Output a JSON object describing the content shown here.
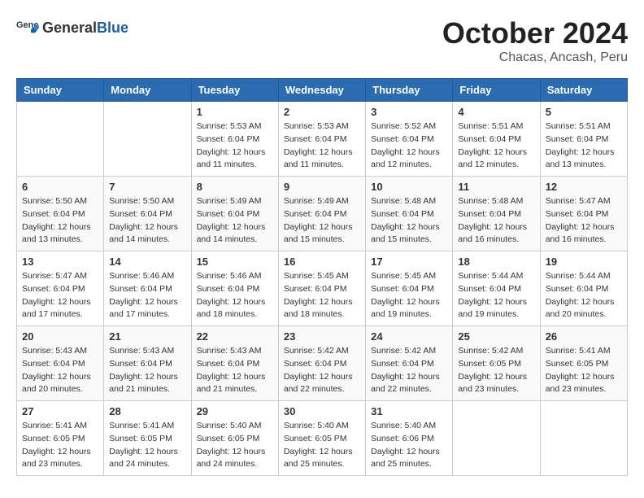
{
  "header": {
    "logo_general": "General",
    "logo_blue": "Blue",
    "month": "October 2024",
    "location": "Chacas, Ancash, Peru"
  },
  "weekdays": [
    "Sunday",
    "Monday",
    "Tuesday",
    "Wednesday",
    "Thursday",
    "Friday",
    "Saturday"
  ],
  "weeks": [
    [
      {
        "day": "",
        "details": ""
      },
      {
        "day": "",
        "details": ""
      },
      {
        "day": "1",
        "details": "Sunrise: 5:53 AM\nSunset: 6:04 PM\nDaylight: 12 hours and 11 minutes."
      },
      {
        "day": "2",
        "details": "Sunrise: 5:53 AM\nSunset: 6:04 PM\nDaylight: 12 hours and 11 minutes."
      },
      {
        "day": "3",
        "details": "Sunrise: 5:52 AM\nSunset: 6:04 PM\nDaylight: 12 hours and 12 minutes."
      },
      {
        "day": "4",
        "details": "Sunrise: 5:51 AM\nSunset: 6:04 PM\nDaylight: 12 hours and 12 minutes."
      },
      {
        "day": "5",
        "details": "Sunrise: 5:51 AM\nSunset: 6:04 PM\nDaylight: 12 hours and 13 minutes."
      }
    ],
    [
      {
        "day": "6",
        "details": "Sunrise: 5:50 AM\nSunset: 6:04 PM\nDaylight: 12 hours and 13 minutes."
      },
      {
        "day": "7",
        "details": "Sunrise: 5:50 AM\nSunset: 6:04 PM\nDaylight: 12 hours and 14 minutes."
      },
      {
        "day": "8",
        "details": "Sunrise: 5:49 AM\nSunset: 6:04 PM\nDaylight: 12 hours and 14 minutes."
      },
      {
        "day": "9",
        "details": "Sunrise: 5:49 AM\nSunset: 6:04 PM\nDaylight: 12 hours and 15 minutes."
      },
      {
        "day": "10",
        "details": "Sunrise: 5:48 AM\nSunset: 6:04 PM\nDaylight: 12 hours and 15 minutes."
      },
      {
        "day": "11",
        "details": "Sunrise: 5:48 AM\nSunset: 6:04 PM\nDaylight: 12 hours and 16 minutes."
      },
      {
        "day": "12",
        "details": "Sunrise: 5:47 AM\nSunset: 6:04 PM\nDaylight: 12 hours and 16 minutes."
      }
    ],
    [
      {
        "day": "13",
        "details": "Sunrise: 5:47 AM\nSunset: 6:04 PM\nDaylight: 12 hours and 17 minutes."
      },
      {
        "day": "14",
        "details": "Sunrise: 5:46 AM\nSunset: 6:04 PM\nDaylight: 12 hours and 17 minutes."
      },
      {
        "day": "15",
        "details": "Sunrise: 5:46 AM\nSunset: 6:04 PM\nDaylight: 12 hours and 18 minutes."
      },
      {
        "day": "16",
        "details": "Sunrise: 5:45 AM\nSunset: 6:04 PM\nDaylight: 12 hours and 18 minutes."
      },
      {
        "day": "17",
        "details": "Sunrise: 5:45 AM\nSunset: 6:04 PM\nDaylight: 12 hours and 19 minutes."
      },
      {
        "day": "18",
        "details": "Sunrise: 5:44 AM\nSunset: 6:04 PM\nDaylight: 12 hours and 19 minutes."
      },
      {
        "day": "19",
        "details": "Sunrise: 5:44 AM\nSunset: 6:04 PM\nDaylight: 12 hours and 20 minutes."
      }
    ],
    [
      {
        "day": "20",
        "details": "Sunrise: 5:43 AM\nSunset: 6:04 PM\nDaylight: 12 hours and 20 minutes."
      },
      {
        "day": "21",
        "details": "Sunrise: 5:43 AM\nSunset: 6:04 PM\nDaylight: 12 hours and 21 minutes."
      },
      {
        "day": "22",
        "details": "Sunrise: 5:43 AM\nSunset: 6:04 PM\nDaylight: 12 hours and 21 minutes."
      },
      {
        "day": "23",
        "details": "Sunrise: 5:42 AM\nSunset: 6:04 PM\nDaylight: 12 hours and 22 minutes."
      },
      {
        "day": "24",
        "details": "Sunrise: 5:42 AM\nSunset: 6:04 PM\nDaylight: 12 hours and 22 minutes."
      },
      {
        "day": "25",
        "details": "Sunrise: 5:42 AM\nSunset: 6:05 PM\nDaylight: 12 hours and 23 minutes."
      },
      {
        "day": "26",
        "details": "Sunrise: 5:41 AM\nSunset: 6:05 PM\nDaylight: 12 hours and 23 minutes."
      }
    ],
    [
      {
        "day": "27",
        "details": "Sunrise: 5:41 AM\nSunset: 6:05 PM\nDaylight: 12 hours and 23 minutes."
      },
      {
        "day": "28",
        "details": "Sunrise: 5:41 AM\nSunset: 6:05 PM\nDaylight: 12 hours and 24 minutes."
      },
      {
        "day": "29",
        "details": "Sunrise: 5:40 AM\nSunset: 6:05 PM\nDaylight: 12 hours and 24 minutes."
      },
      {
        "day": "30",
        "details": "Sunrise: 5:40 AM\nSunset: 6:05 PM\nDaylight: 12 hours and 25 minutes."
      },
      {
        "day": "31",
        "details": "Sunrise: 5:40 AM\nSunset: 6:06 PM\nDaylight: 12 hours and 25 minutes."
      },
      {
        "day": "",
        "details": ""
      },
      {
        "day": "",
        "details": ""
      }
    ]
  ]
}
